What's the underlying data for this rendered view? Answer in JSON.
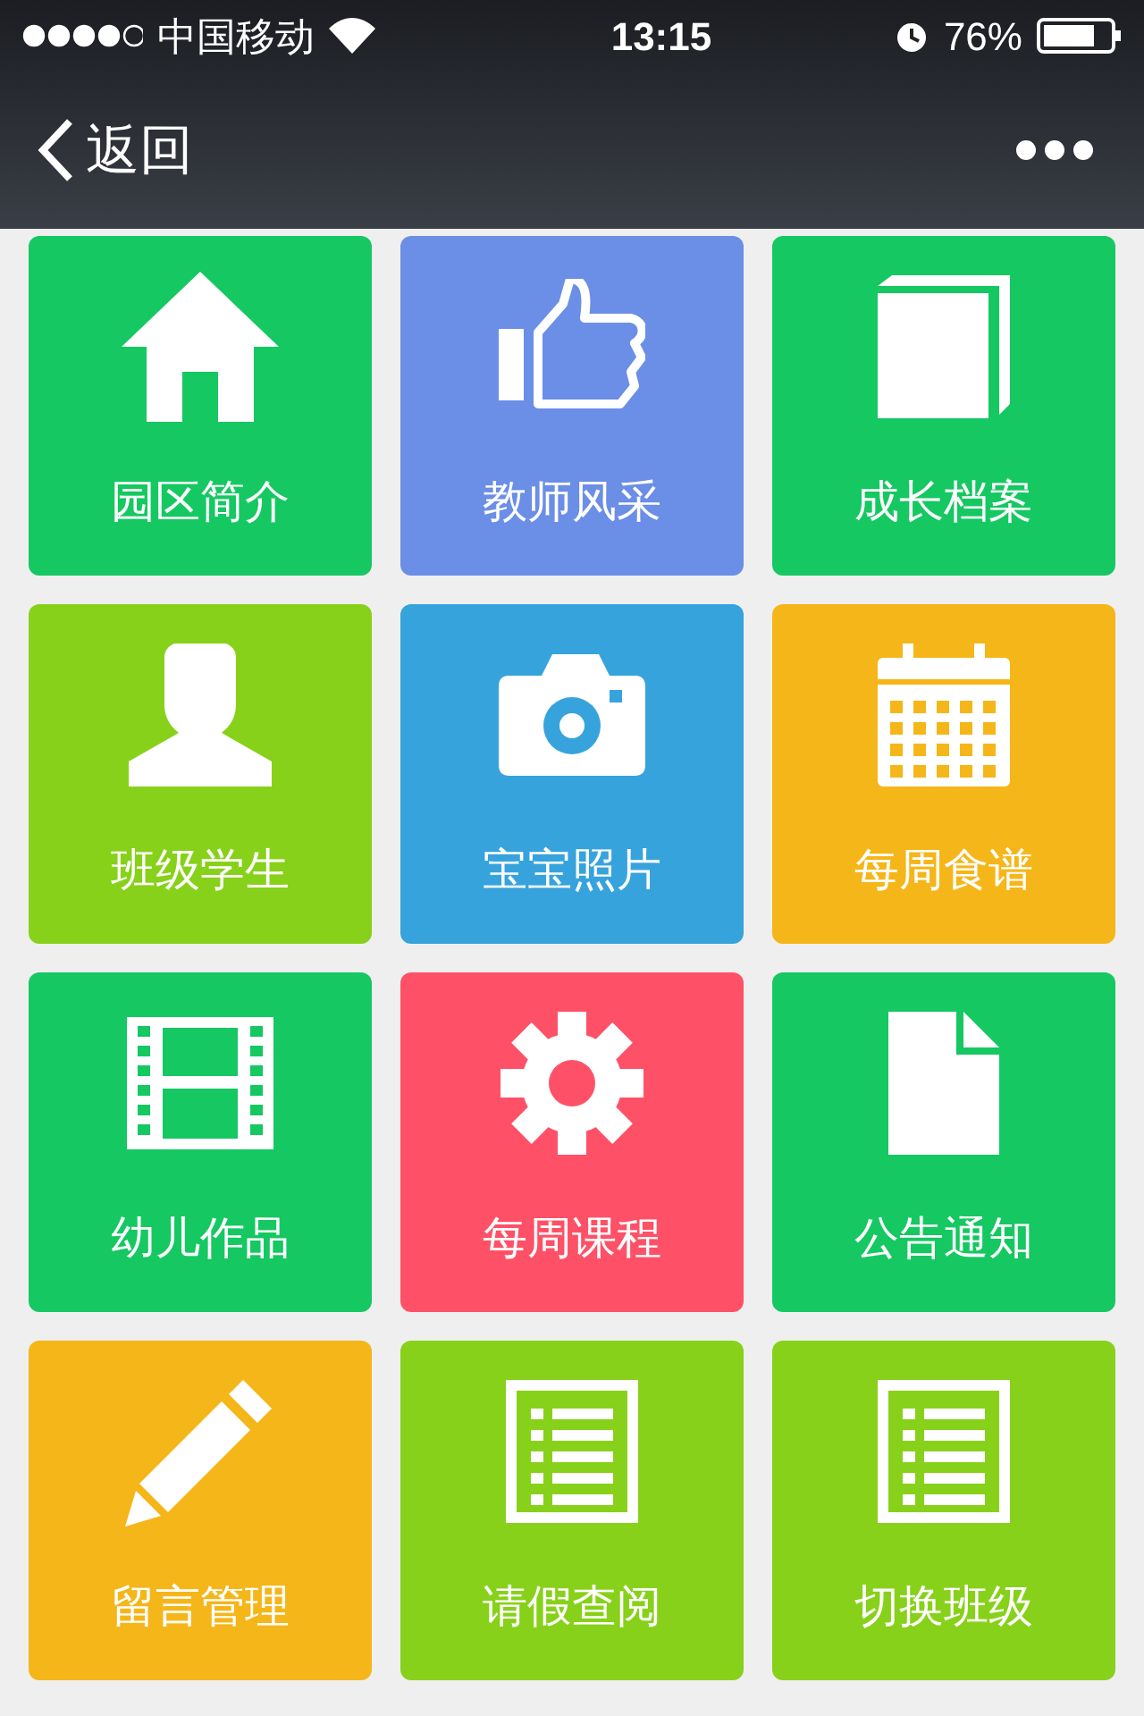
{
  "status_bar": {
    "carrier": "中国移动",
    "time": "13:15",
    "battery": "76%"
  },
  "nav": {
    "back": "返回"
  },
  "tiles": [
    {
      "label": "园区简介",
      "color": "#15c862"
    },
    {
      "label": "教师风采",
      "color": "#6b8ee6"
    },
    {
      "label": "成长档案",
      "color": "#15c862"
    },
    {
      "label": "班级学生",
      "color": "#87d11a"
    },
    {
      "label": "宝宝照片",
      "color": "#37a3dc"
    },
    {
      "label": "每周食谱",
      "color": "#f5b619"
    },
    {
      "label": "幼儿作品",
      "color": "#15c862"
    },
    {
      "label": "每周课程",
      "color": "#fe5167"
    },
    {
      "label": "公告通知",
      "color": "#15c862"
    },
    {
      "label": "留言管理",
      "color": "#f5b619"
    },
    {
      "label": "请假查阅",
      "color": "#87d11a"
    },
    {
      "label": "切换班级",
      "color": "#87d11a"
    }
  ]
}
